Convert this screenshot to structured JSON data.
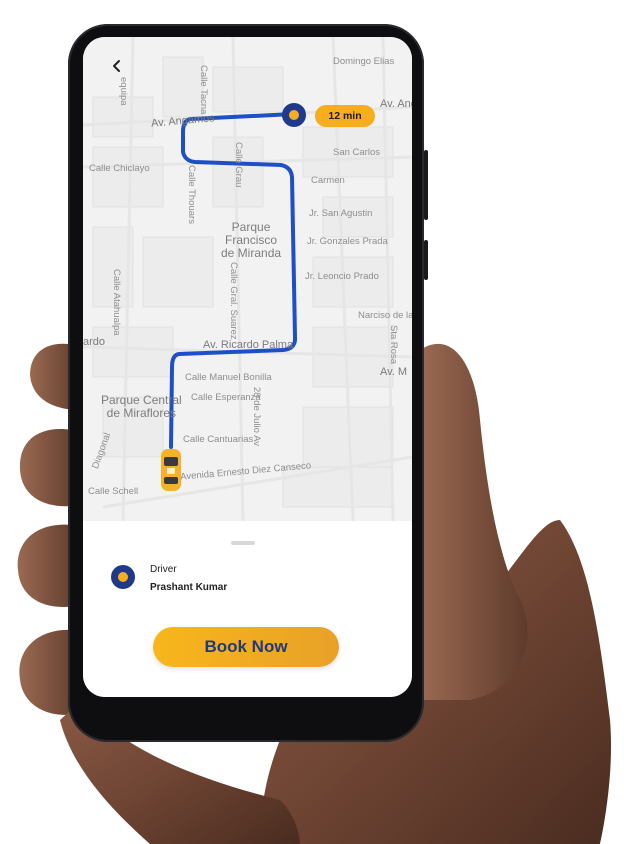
{
  "map": {
    "eta": "12 min",
    "streets": {
      "domingo_elias": "Domingo Elias",
      "calle_tacna": "Calle Tacna",
      "av_angamos_left": "Av. Angamos",
      "av_angamos_right": "Av. Ang",
      "arequipa": "equipa",
      "calle_grau": "Calle Grau",
      "san_carlos": "San Carlos",
      "calle_chiclayo": "Calle Chiclayo",
      "calle_thouars": "Calle Thouars",
      "carmen": "Carmen",
      "jr_san_agustin": "Jr. San Agustin",
      "parque_francisco": "Parque\nFrancisco\nde Miranda",
      "jr_gonzales_prada": "Jr. Gonzales Prada",
      "calle_atahualpa": "Calle Atahualpa",
      "calle_gral_suarez": "Calle Gral. Suarez",
      "jr_leoncio_prado": "Jr. Leoncio Prado",
      "narciso": "Narciso de la C",
      "ardo": "ardo",
      "sta_rosa": "Sta Rosa",
      "av_ricardo_palma": "Av. Ricardo Palma",
      "av_m": "Av. M",
      "calle_manuel_bonilla": "Calle Manuel Bonilla",
      "parque_central": "Parque Central\nde Miraflores",
      "calle_esperanza": "Calle Esperanza",
      "av_28_julio": "28 de Julio Av",
      "diagonal": "Diagonal",
      "calle_cantuarias": "Calle Cantuarias",
      "avenida_ernesto": "Avenida Ernesto Diez Canseco",
      "calle_schell": "Calle Schell"
    }
  },
  "driver": {
    "role": "Driver",
    "name": "Prashant Kumar"
  },
  "actions": {
    "book_now": "Book Now"
  },
  "icons": {
    "back": "chevron-left-icon",
    "car": "taxi-car-icon",
    "destination": "location-pin-icon",
    "avatar": "driver-avatar-icon"
  },
  "colors": {
    "route": "#1e4fc4",
    "accent": "#f6ad1e",
    "button_text": "#233a78",
    "avatar": "#1f3a8a"
  }
}
